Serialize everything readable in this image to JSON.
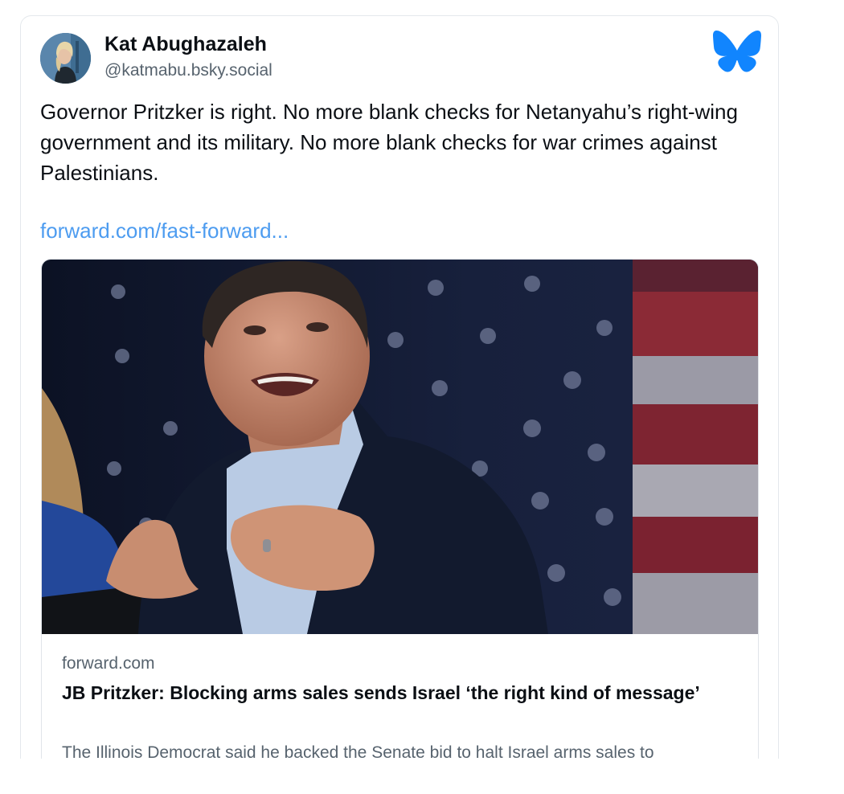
{
  "author": {
    "display_name": "Kat Abughazaleh",
    "handle": "@katmabu.bsky.social",
    "avatar_icon": "avatar-photo"
  },
  "brand": {
    "logo_icon": "bluesky-butterfly-icon",
    "color": "#1185fe"
  },
  "post": {
    "text": "Governor Pritzker is right. No more blank checks for Netanyahu’s right-wing government and its military. No more blank checks for war crimes against Palestinians.",
    "link_text": "forward.com/fast-forward..."
  },
  "embed": {
    "image_icon": "article-photo",
    "domain": "forward.com",
    "title": "JB Pritzker: Blocking arms sales sends Israel ‘the right kind of message’",
    "description": "The Illinois Democrat said he backed the Senate bid to halt Israel arms sales to"
  },
  "colors": {
    "link": "#4d9cf0",
    "muted_text": "#57636e",
    "border": "#e4e8ec"
  }
}
